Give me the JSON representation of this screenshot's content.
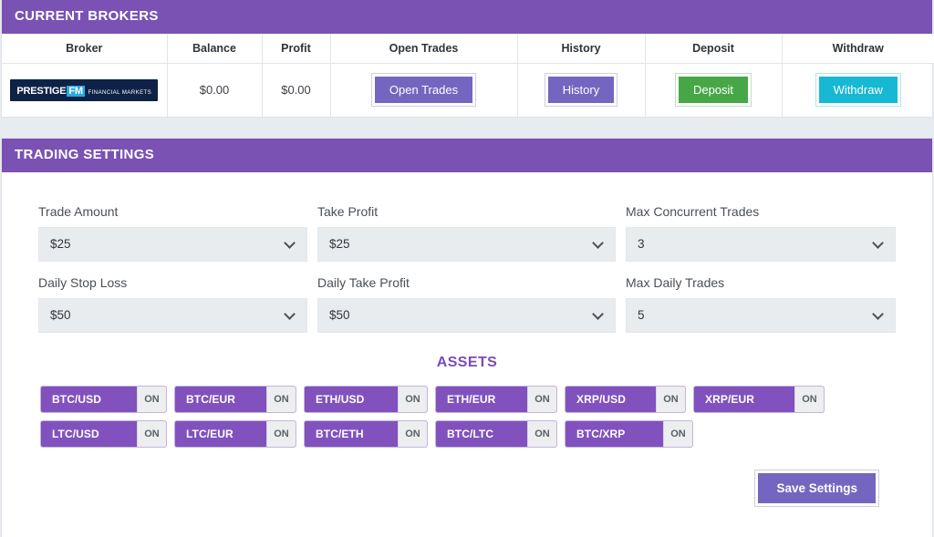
{
  "theme": {
    "header_purple": "#7a52b3",
    "asset_purple": "#8152bd",
    "button_purple": "#7466c0",
    "green": "#47a747",
    "cyan": "#17b8d4",
    "page_bg": "#e8ebef",
    "assets_title_color": "#7a4bb8"
  },
  "brokers": {
    "header": "CURRENT BROKERS",
    "columns": [
      "Broker",
      "Balance",
      "Profit",
      "Open Trades",
      "History",
      "Deposit",
      "Withdraw"
    ],
    "row": {
      "logo_main": "PRESTIGE",
      "logo_accent": "FM",
      "logo_sub": "FINANCIAL MARKETS",
      "balance": "$0.00",
      "profit": "$0.00",
      "open_trades_label": "Open Trades",
      "history_label": "History",
      "deposit_label": "Deposit",
      "withdraw_label": "Withdraw"
    }
  },
  "settings": {
    "header": "TRADING SETTINGS",
    "fields": [
      {
        "label": "Trade Amount",
        "value": "$25"
      },
      {
        "label": "Take Profit",
        "value": "$25"
      },
      {
        "label": "Max Concurrent Trades",
        "value": "3"
      },
      {
        "label": "Daily Stop Loss",
        "value": "$50"
      },
      {
        "label": "Daily Take Profit",
        "value": "$50"
      },
      {
        "label": "Max Daily Trades",
        "value": "5"
      }
    ],
    "assets_title": "ASSETS",
    "assets_row1": [
      {
        "name": "BTC/USD",
        "state": "ON"
      },
      {
        "name": "BTC/EUR",
        "state": "ON"
      },
      {
        "name": "ETH/USD",
        "state": "ON"
      },
      {
        "name": "ETH/EUR",
        "state": "ON"
      },
      {
        "name": "XRP/USD",
        "state": "ON"
      },
      {
        "name": "XRP/EUR",
        "state": "ON"
      }
    ],
    "assets_row2": [
      {
        "name": "LTC/USD",
        "state": "ON"
      },
      {
        "name": "LTC/EUR",
        "state": "ON"
      },
      {
        "name": "BTC/ETH",
        "state": "ON"
      },
      {
        "name": "BTC/LTC",
        "state": "ON"
      },
      {
        "name": "BTC/XRP",
        "state": "ON"
      }
    ],
    "save_label": "Save Settings"
  }
}
